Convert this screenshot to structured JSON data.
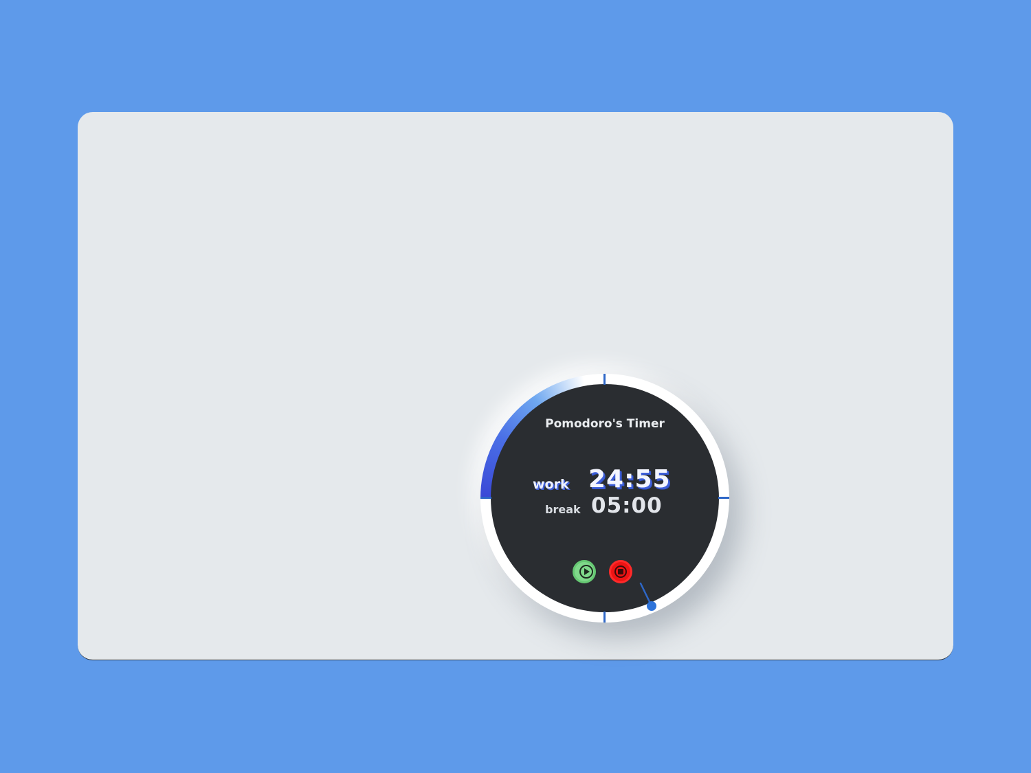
{
  "app": {
    "title": "Pomodoro's Timer"
  },
  "timer": {
    "work_label": "work",
    "work_time": "24:55",
    "break_label": "break",
    "break_time": "05:00",
    "work_total_minutes": 25,
    "work_elapsed_seconds": 5
  },
  "controls": {
    "play_icon": "play-icon",
    "stop_icon": "stop-icon"
  },
  "colors": {
    "page_background": "#5e9aea",
    "card_background": "#e5e9ec",
    "face": "#2a2d31",
    "accent_blue": "#2e67c7",
    "play_green": "#7fd88a",
    "stop_red": "#ee1414"
  }
}
